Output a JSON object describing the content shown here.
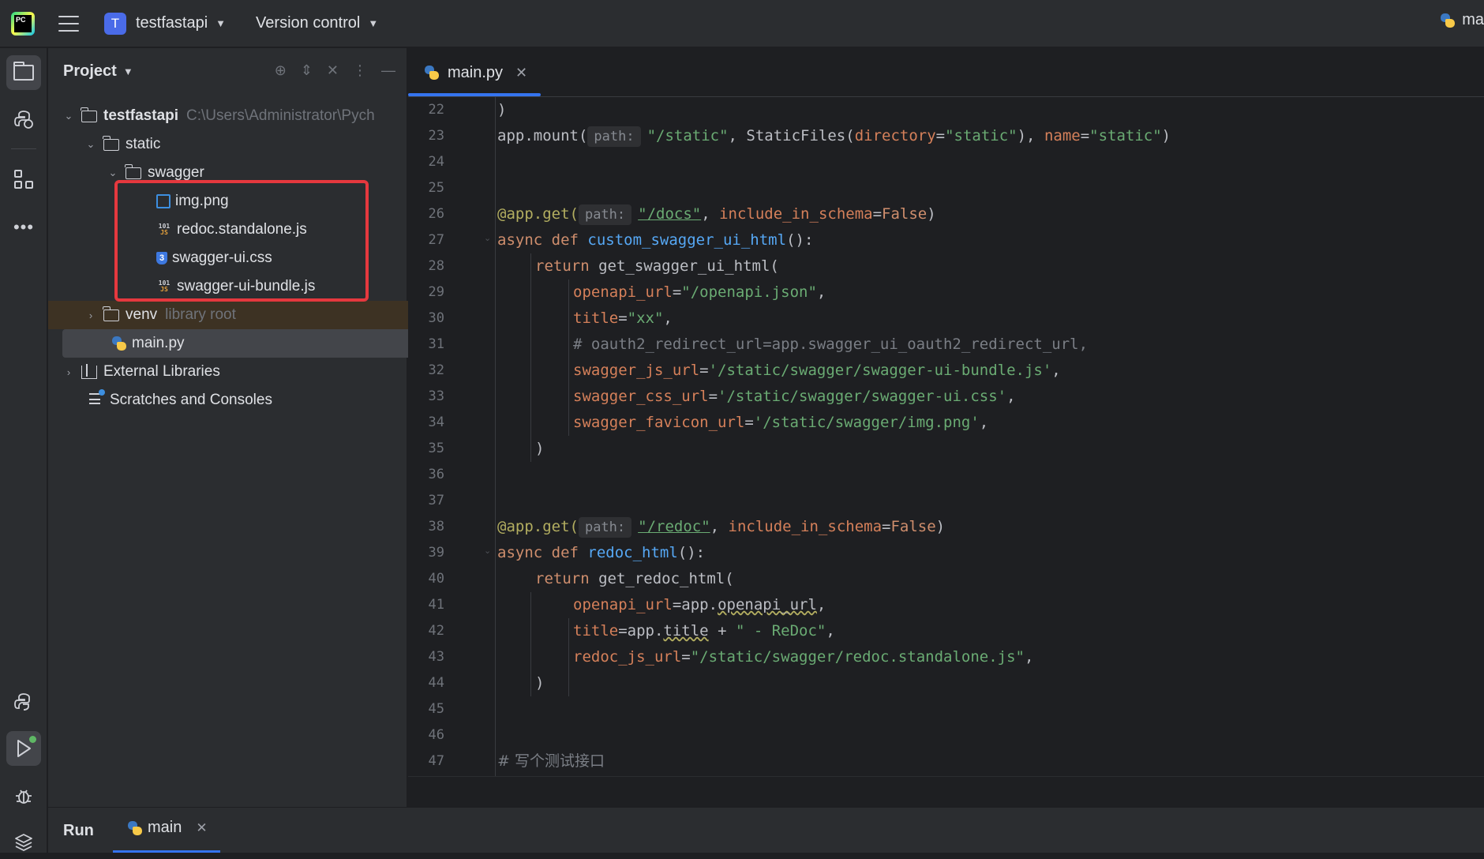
{
  "header": {
    "project_badge": "T",
    "project_name": "testfastapi",
    "vcs_label": "Version control",
    "run_config": "ma"
  },
  "project_panel": {
    "title": "Project",
    "tree": {
      "root": {
        "name": "testfastapi",
        "path": "C:\\Users\\Administrator\\Pych"
      },
      "static": "static",
      "swagger": "swagger",
      "files": [
        "img.png",
        "redoc.standalone.js",
        "swagger-ui.css",
        "swagger-ui-bundle.js"
      ],
      "venv": {
        "name": "venv",
        "note": "library root"
      },
      "main": "main.py",
      "external": "External Libraries",
      "scratches": "Scratches and Consoles"
    }
  },
  "editor": {
    "tab": "main.py",
    "line_numbers": [
      "22",
      "23",
      "24",
      "25",
      "26",
      "27",
      "28",
      "29",
      "30",
      "31",
      "32",
      "33",
      "34",
      "35",
      "36",
      "37",
      "38",
      "39",
      "40",
      "41",
      "42",
      "43",
      "44",
      "45",
      "46",
      "47"
    ],
    "hint_path": "path:",
    "code": {
      "l22": ")",
      "l23_call": "app.mount(",
      "l23_path": "\"/static\"",
      "l23_mid": ", StaticFiles(",
      "l23_dir_kw": "directory",
      "l23_dir_val": "\"static\"",
      "l23_sep": "), ",
      "l23_name_kw": "name",
      "l23_name_val": "\"static\"",
      "l23_end": ")",
      "l26_deco": "@app.get(",
      "l26_path": "\"/docs\"",
      "l26_kw": "include_in_schema",
      "l26_val": "False",
      "l27_async": "async def ",
      "l27_fn": "custom_swagger_ui_html",
      "l27_tail": "():",
      "l28_ret": "return ",
      "l28_call": "get_swagger_ui_html(",
      "l29_kw": "openapi_url",
      "l29_val": "\"/openapi.json\"",
      "l30_kw": "title",
      "l30_val": "\"xx\"",
      "l31_comment": "# oauth2_redirect_url=app.swagger_ui_oauth2_redirect_url,",
      "l32_kw": "swagger_js_url",
      "l32_val": "'/static/swagger/swagger-ui-bundle.js'",
      "l33_kw": "swagger_css_url",
      "l33_val": "'/static/swagger/swagger-ui.css'",
      "l34_kw": "swagger_favicon_url",
      "l34_val": "'/static/swagger/img.png'",
      "l35": ")",
      "l38_deco": "@app.get(",
      "l38_path": "\"/redoc\"",
      "l38_kw": "include_in_schema",
      "l38_val": "False",
      "l39_async": "async def ",
      "l39_fn": "redoc_html",
      "l39_tail": "():",
      "l40_ret": "return ",
      "l40_call": "get_redoc_html(",
      "l41_kw": "openapi_url",
      "l41_obj": "app.",
      "l41_attr": "openapi_url",
      "l42_kw": "title",
      "l42_obj": "app.",
      "l42_attr": "title",
      "l42_op": " + ",
      "l42_val": "\" - ReDoc\"",
      "l43_kw": "redoc_js_url",
      "l43_val": "\"/static/swagger/redoc.standalone.js\"",
      "l44": ")",
      "l47_comment": "# 写个测试接口"
    }
  },
  "bottom": {
    "run_label": "Run",
    "tab": "main"
  },
  "colors": {
    "highlight_box": "#e5383e",
    "accent": "#3574f0"
  }
}
